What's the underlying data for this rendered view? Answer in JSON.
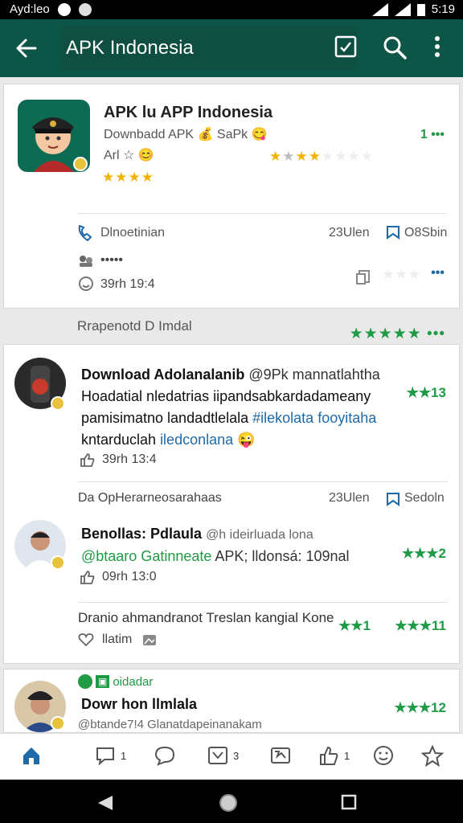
{
  "status": {
    "left_text": "Ayd:leo",
    "time": "5:19"
  },
  "appbar": {
    "title": "APK Indonesia"
  },
  "app_card": {
    "title": "APK lu APP Indonesia",
    "subtitle": "Downbadd APK 💰 SaPk 😋",
    "meta": "Arl ☆ 😊",
    "rating_stars": "★★★★",
    "more": "1 •••",
    "row_label": "Dlnoetinian",
    "row_date": "23Ulen",
    "row_action": "O8Sbin",
    "dots": "•••••",
    "time": "39rh 19:4"
  },
  "between": {
    "text": "Rrapenotd D Imdal",
    "stars": "★★★★★ •••"
  },
  "posts": [
    {
      "heading": "Download Adolanalanib",
      "handle": "@9Pk mannatlahtha",
      "line2": "Hoadatial nledatrias iipandsabkardadameany",
      "line3_pre": "pamisimatno landadtlelala ",
      "line3_tag": "#ilekolata fooyitaha",
      "line4_pre": "kntarduclah ",
      "line4_tag": "iledconlana",
      "line4_emoji": "😜",
      "time": "39rh 13:4",
      "score": "★★13"
    },
    {
      "subheader": "Da OpHerarneosarahaas",
      "date": "23Ulen",
      "action": "Sedoln"
    },
    {
      "heading": "Benollas: Pdlaula",
      "handle": "@h ideirluada lona",
      "line2_tag": "@btaaro Gatinneate",
      "line2_rest": " APK; lldonsá: 109nal",
      "time": "09rh 13:0",
      "score": "★★★2"
    },
    {
      "text": "Dranio ahmandranot Treslan kangial  Kone",
      "reply_label": "llatim",
      "score_a": "★★1",
      "score_b": "★★★11"
    },
    {
      "badge": "oidadar",
      "heading": "Dowr hon llmlala",
      "handle": "@btande7!4 Glanatdapeinanakam",
      "score": "★★★12"
    }
  ],
  "bottomnav": {
    "count_comment": "1",
    "count_share": "3",
    "count_like": "1"
  }
}
